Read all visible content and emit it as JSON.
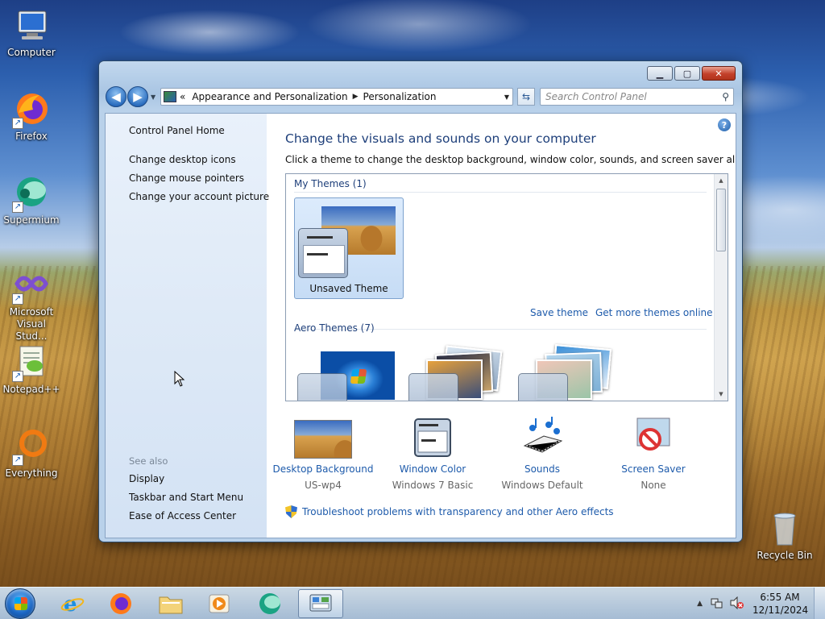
{
  "desktop": {
    "icons": [
      {
        "label": "Computer"
      },
      {
        "label": "Firefox"
      },
      {
        "label": "Supermium"
      },
      {
        "label": "Microsoft Visual Stud..."
      },
      {
        "label": "Notepad++"
      },
      {
        "label": "Everything"
      },
      {
        "label": "Recycle Bin"
      }
    ]
  },
  "window": {
    "nav": {
      "back_label": "Back",
      "forward_label": "Forward",
      "breadcrumb_prefix": "«",
      "breadcrumb": [
        "Appearance and Personalization",
        "Personalization"
      ],
      "search_placeholder": "Search Control Panel"
    },
    "left_pane": {
      "home": "Control Panel Home",
      "links": [
        "Change desktop icons",
        "Change mouse pointers",
        "Change your account picture"
      ],
      "see_also_title": "See also",
      "see_also": [
        "Display",
        "Taskbar and Start Menu",
        "Ease of Access Center"
      ]
    },
    "main": {
      "heading": "Change the visuals and sounds on your computer",
      "subtext": "Click a theme to change the desktop background, window color, sounds, and screen saver all at once.",
      "my_themes_title": "My Themes (1)",
      "unsaved_theme_label": "Unsaved Theme",
      "save_theme": "Save theme",
      "get_more": "Get more themes online",
      "aero_themes_title": "Aero Themes (7)",
      "quick_settings": [
        {
          "title": "Desktop Background",
          "value": "US-wp4",
          "icon": "landscape-icon"
        },
        {
          "title": "Window Color",
          "value": "Windows 7 Basic",
          "icon": "window-color-icon"
        },
        {
          "title": "Sounds",
          "value": "Windows Default",
          "icon": "music-notes-icon"
        },
        {
          "title": "Screen Saver",
          "value": "None",
          "icon": "no-screensaver-icon"
        }
      ],
      "troubleshoot": "Troubleshoot problems with transparency and other Aero effects"
    }
  },
  "taskbar": {
    "time": "6:55 AM",
    "date": "12/11/2024",
    "apps": [
      "Internet Explorer",
      "Firefox",
      "File Explorer",
      "Media Player",
      "Supermium",
      "Control Panel"
    ]
  }
}
